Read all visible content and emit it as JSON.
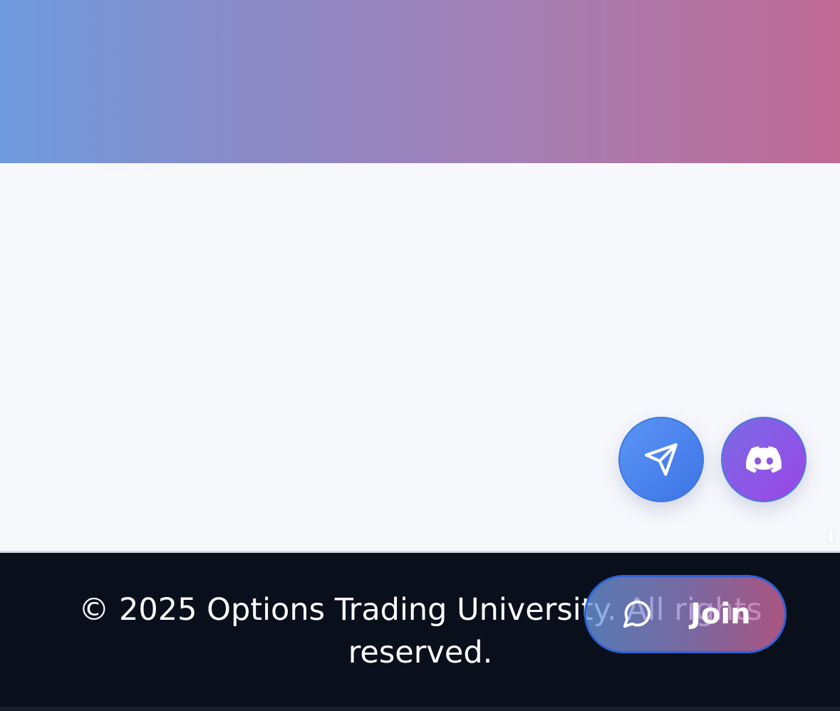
{
  "footer": {
    "copyright": "© 2025 Options Trading University. All rights reserved."
  },
  "floating_actions": {
    "telegram": {
      "icon": "send-icon"
    },
    "discord": {
      "icon": "discord-icon"
    },
    "join": {
      "label": "Join",
      "icon": "chat-bubble-icon"
    }
  },
  "colors": {
    "hero_gradient_start": "#6e9bde",
    "hero_gradient_end": "#c06a94",
    "page_background": "#f7f8fc",
    "footer_background": "#0a0f1c",
    "telegram_blue": "#4a86ee",
    "discord_purple": "#8b57e6"
  }
}
